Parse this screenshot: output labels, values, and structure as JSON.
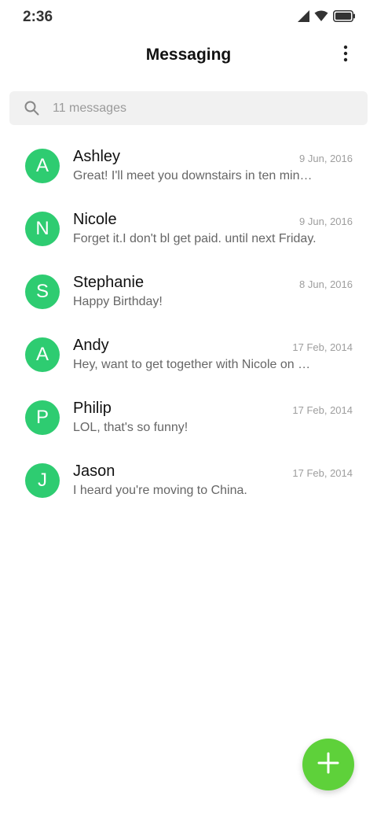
{
  "status_bar": {
    "time": "2:36",
    "icons": [
      "signal-icon",
      "wifi-icon",
      "battery-icon"
    ]
  },
  "header": {
    "title": "Messaging",
    "menu_icon": "more-vert-icon"
  },
  "search": {
    "placeholder": "11 messages",
    "icon": "search-icon"
  },
  "messages": [
    {
      "initial": "A",
      "name": "Ashley",
      "date": "9 Jun, 2016",
      "preview": "Great! I'll meet you downstairs in ten minutes."
    },
    {
      "initial": "N",
      "name": "Nicole",
      "date": "9 Jun, 2016",
      "preview": "Forget it.I don't bl get paid. until next Friday."
    },
    {
      "initial": "S",
      "name": "Stephanie",
      "date": "8 Jun, 2016",
      "preview": "Happy Birthday!"
    },
    {
      "initial": "A",
      "name": "Andy",
      "date": "17 Feb, 2014",
      "preview": "Hey, want to get together with Nicole on Friday?"
    },
    {
      "initial": "P",
      "name": "Philip",
      "date": "17 Feb, 2014",
      "preview": "LOL, that's so funny!"
    },
    {
      "initial": "J",
      "name": "Jason",
      "date": "17 Feb, 2014",
      "preview": "I heard you're moving to China."
    }
  ],
  "fab": {
    "icon": "plus-icon"
  },
  "colors": {
    "avatar": "#2ecc71",
    "fab": "#5ed13a",
    "search_bg": "#f1f1f1"
  }
}
